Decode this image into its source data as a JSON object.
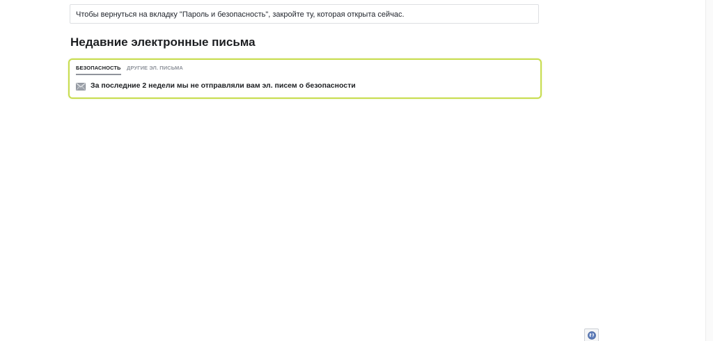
{
  "notice": {
    "text": "Чтобы вернуться на вкладку \"Пароль и безопасность\", закройте ту, которая открыта сейчас."
  },
  "section": {
    "title": "Недавние электронные письма"
  },
  "tabs": [
    {
      "label": "БЕЗОПАСНОСТЬ",
      "active": true
    },
    {
      "label": "ДРУГИЕ ЭЛ. ПИСЬМА",
      "active": false
    }
  ],
  "message": {
    "icon": "envelope-icon",
    "text": "За последние 2 недели мы не отправляли вам эл. писем о безопасности"
  },
  "footer": {
    "language_icon": "globe-icon"
  },
  "colors": {
    "card_border": "#c8dd4f",
    "active_tab_underline": "#90949c",
    "inactive_tab_text": "#90949c"
  }
}
